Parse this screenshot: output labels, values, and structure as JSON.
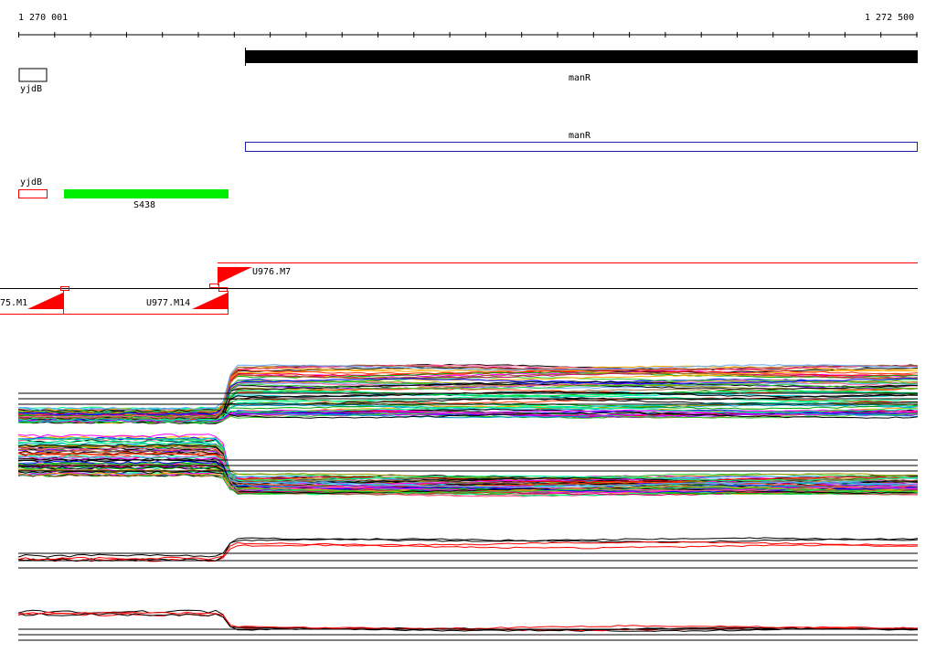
{
  "ruler": {
    "start_label": "1 270 001",
    "end_label": "1 272 500"
  },
  "features": {
    "gene_track": [
      {
        "name": "yjdB",
        "style": "outline-black"
      },
      {
        "name": "manR",
        "style": "filled-black"
      }
    ],
    "cds_track": [
      {
        "name": "manR",
        "style": "outline-blue"
      }
    ],
    "other_track": [
      {
        "name": "yjdB",
        "style": "outline-red"
      },
      {
        "name": "S438",
        "style": "filled-green"
      }
    ]
  },
  "transcripts": {
    "upper": {
      "name": "U976.M7"
    },
    "lower": [
      {
        "name": "75.M1"
      },
      {
        "name": "U977.M14"
      }
    ]
  },
  "colors": {
    "black": "#000000",
    "red": "#ff0000",
    "blue": "#1f1fb4",
    "green": "#00ee00"
  },
  "expression_panels": [
    {
      "name": "panel-1",
      "profile": "step-up-at-manR-start",
      "series_count": 60
    },
    {
      "name": "panel-2",
      "profile": "step-down-at-manR-start",
      "series_count": 60
    },
    {
      "name": "panel-3",
      "profile": "step-up-at-manR-start",
      "series_count": 4
    },
    {
      "name": "panel-4",
      "profile": "step-down-at-manR-start",
      "series_count": 4
    }
  ]
}
